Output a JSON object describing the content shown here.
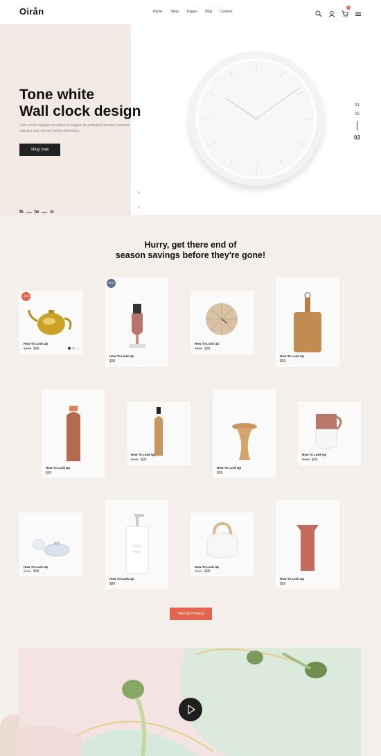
{
  "header": {
    "logo": "Oirån",
    "nav": [
      "Home",
      "Shop",
      "Pages",
      "Blog",
      "Contact"
    ],
    "cart_count": "0"
  },
  "hero": {
    "title_line1": "Tone white",
    "title_line2": "Wall clock design",
    "description": "Cum sociis natoque penatibus et magnis dis parturient montes nascetur ridiculus mus aenean lacinia bibendum.",
    "cta": "shop now",
    "social": [
      "fb",
      "tw",
      "in"
    ],
    "slides": [
      "01",
      "02",
      "03"
    ]
  },
  "section": {
    "title_line1": "Hurry, get there end of",
    "title_line2": "season savings before they're gone!"
  },
  "products": [
    {
      "name": "How To Look Up",
      "old_price": "$100",
      "price": "$99",
      "badge": "-10%",
      "badge_color": "#e3654f"
    },
    {
      "name": "How To Look Up",
      "old_price": "",
      "price": "$99",
      "badge": "NEW",
      "badge_color": "#5c6f8c"
    },
    {
      "name": "How To Look Up",
      "old_price": "$100",
      "price": "$99",
      "badge": ""
    },
    {
      "name": "How To Look Up",
      "old_price": "",
      "price": "$99",
      "badge": ""
    },
    {
      "name": "How To Look Up",
      "old_price": "",
      "price": "$99",
      "badge": ""
    },
    {
      "name": "How To Look Up",
      "old_price": "$100",
      "price": "$99",
      "badge": ""
    },
    {
      "name": "How To Look Up",
      "old_price": "",
      "price": "$99",
      "badge": ""
    },
    {
      "name": "How To Look Up",
      "old_price": "$100",
      "price": "$99",
      "badge": ""
    },
    {
      "name": "How To Look Up",
      "old_price": "$100",
      "price": "$99",
      "badge": ""
    },
    {
      "name": "How To Look Up",
      "old_price": "",
      "price": "$99",
      "badge": ""
    },
    {
      "name": "How To Look Up",
      "old_price": "$100",
      "price": "$99",
      "badge": ""
    },
    {
      "name": "How To Look Up",
      "old_price": "",
      "price": "$99",
      "badge": ""
    }
  ],
  "view_all": "View all Products",
  "colors": {
    "accent": "#e3654f",
    "dark": "#222222",
    "hero_bg": "#f4eae5",
    "page_bg": "#f4efea"
  }
}
